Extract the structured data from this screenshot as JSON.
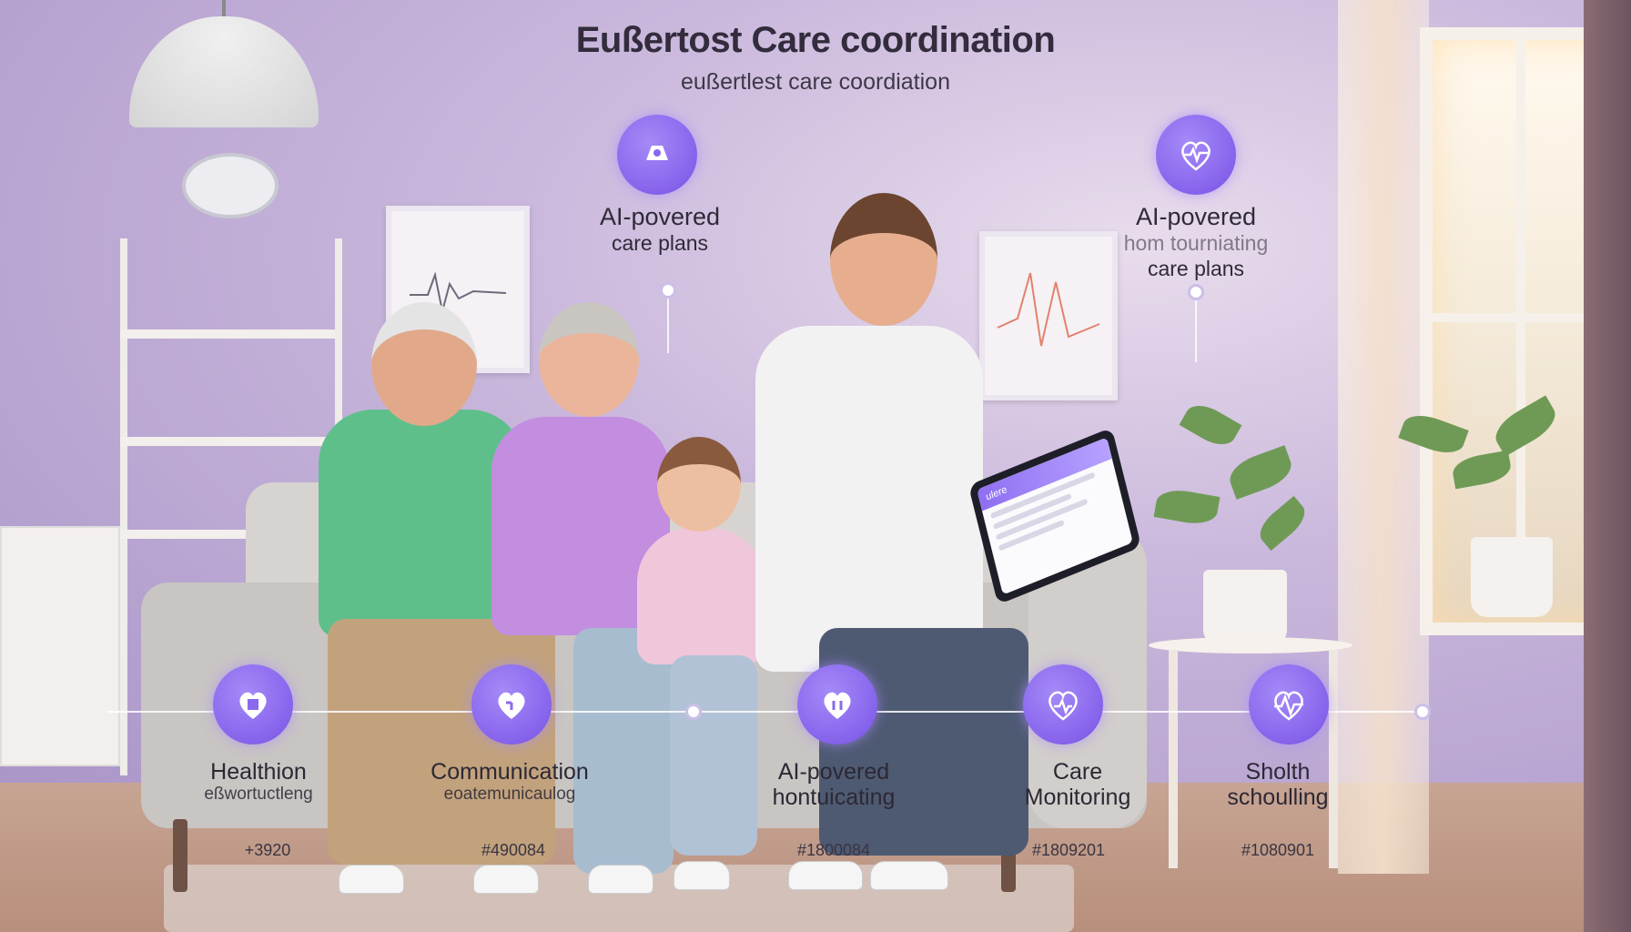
{
  "header": {
    "title": "Eußertost Care coordination",
    "subtitle": "eußertlest care coordiation"
  },
  "top_features": [
    {
      "icon": "assist-icon",
      "line1": "AI-povered",
      "line2": "care plans"
    },
    {
      "icon": "heartbeat-icon",
      "line1": "AI-povered",
      "line2": "hom tourniating",
      "line3": "care plans"
    }
  ],
  "timeline": [
    {
      "icon": "health-kit-icon",
      "title": "Healthion",
      "subtitle": "eßwortuctleng",
      "code": "+3920"
    },
    {
      "icon": "heart-icon",
      "title": "Communication",
      "subtitle": "eoatemunicaulog",
      "code": "#490084"
    },
    {
      "icon": "heart-hands-icon",
      "title": "AI-povered",
      "subtitle": "hontuicating",
      "code": "#1800084"
    },
    {
      "icon": "heart-pulse-icon",
      "title": "Care",
      "subtitle": "Monitoring",
      "code": "#1809201"
    },
    {
      "icon": "pulse-icon",
      "title": "Sholth",
      "subtitle": "schoulling",
      "code": "#1080901"
    }
  ],
  "tablet": {
    "brand": "ulere"
  },
  "colors": {
    "accent": "#8b69ee",
    "wall": "#c9b7dc"
  }
}
